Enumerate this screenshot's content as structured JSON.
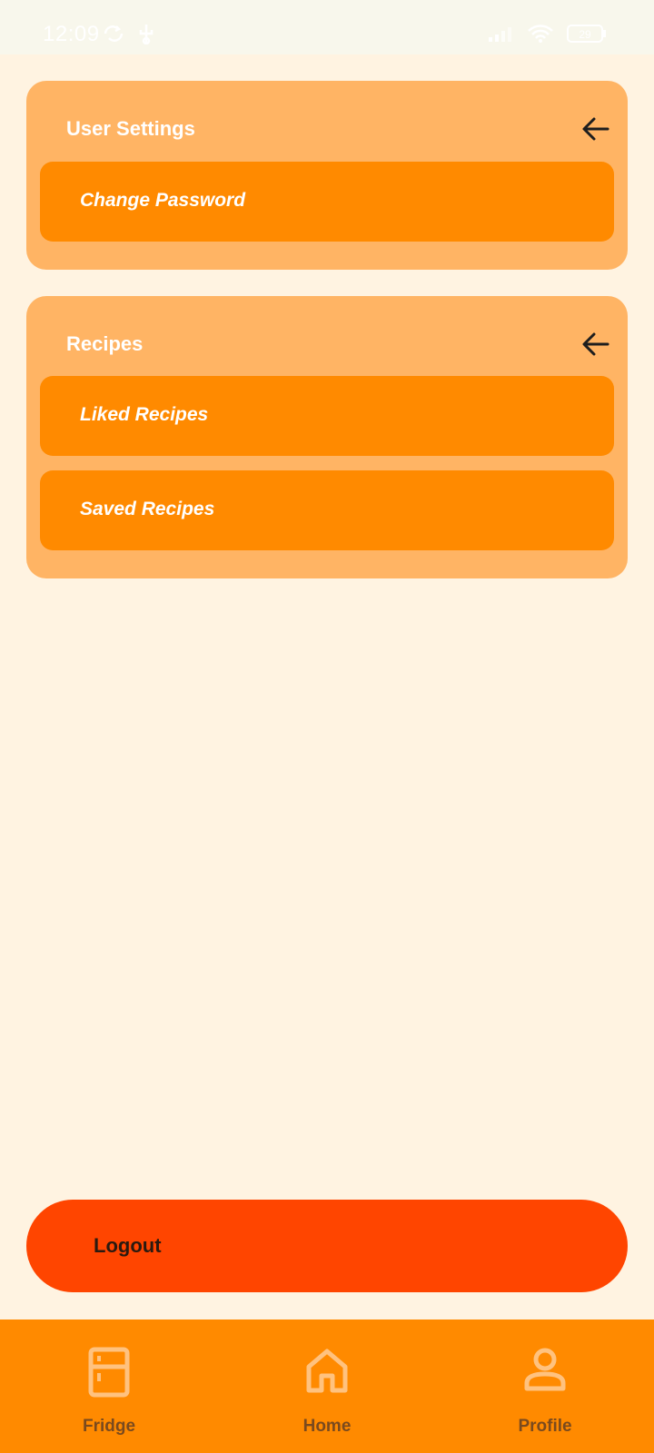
{
  "status_bar": {
    "time": "12:09",
    "battery": "29"
  },
  "sections": [
    {
      "title": "User Settings",
      "items": [
        {
          "label": "Change Password"
        }
      ]
    },
    {
      "title": "Recipes",
      "items": [
        {
          "label": "Liked Recipes"
        },
        {
          "label": "Saved Recipes"
        }
      ]
    }
  ],
  "logout": {
    "label": "Logout"
  },
  "bottom_nav": [
    {
      "label": "Fridge",
      "icon": "fridge-icon"
    },
    {
      "label": "Home",
      "icon": "home-icon"
    },
    {
      "label": "Profile",
      "icon": "profile-icon"
    }
  ],
  "colors": {
    "background": "#FFF3E1",
    "card": "#FFB464",
    "item": "#FF8A00",
    "logout": "#FF4500",
    "nav": "#FF8A00"
  }
}
